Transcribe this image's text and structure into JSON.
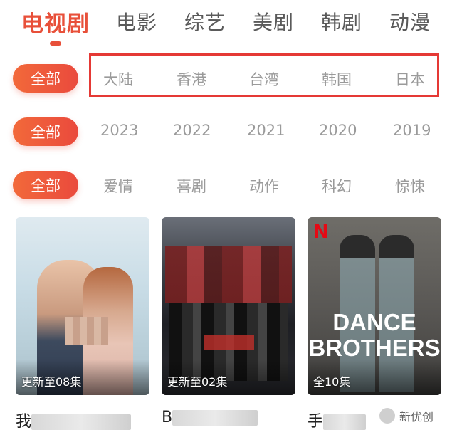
{
  "top_tabs": [
    "电视剧",
    "电影",
    "综艺",
    "美剧",
    "韩剧",
    "动漫"
  ],
  "filters": {
    "region": {
      "all_label": "全部",
      "options": [
        "大陆",
        "香港",
        "台湾",
        "韩国",
        "日本"
      ]
    },
    "year": {
      "all_label": "全部",
      "options": [
        "2023",
        "2022",
        "2021",
        "2020",
        "2019"
      ]
    },
    "genre": {
      "all_label": "全部",
      "options": [
        "爱情",
        "喜剧",
        "动作",
        "科幻",
        "惊悚"
      ]
    }
  },
  "cards": [
    {
      "badge": "更新至08集",
      "title_visible": "我"
    },
    {
      "badge": "更新至02集",
      "title_visible": "B"
    },
    {
      "badge": "全10集",
      "title_visible": "手"
    }
  ],
  "poster3_text": {
    "brand": "N",
    "line1": "DANCE",
    "line2": "BROTHERS"
  },
  "watermark": "新优创",
  "colors": {
    "accent": "#e8503a",
    "highlight": "#e53935"
  }
}
